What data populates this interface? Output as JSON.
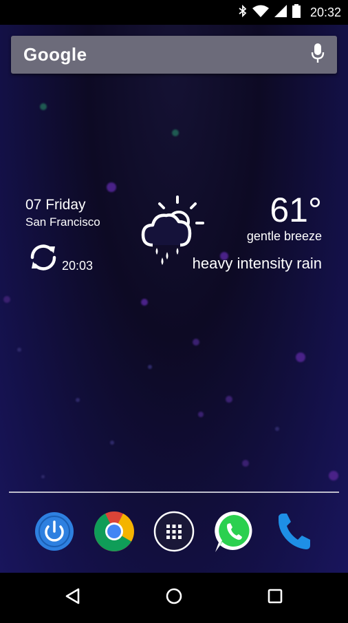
{
  "status_bar": {
    "time": "20:32",
    "icons": [
      "bluetooth-icon",
      "wifi-icon",
      "signal-icon",
      "battery-icon"
    ]
  },
  "search": {
    "logo_text": "Google",
    "mic_icon": "mic-icon"
  },
  "weather_widget": {
    "date": "07 Friday",
    "city": "San Francisco",
    "last_updated": "20:03",
    "temperature": "61°",
    "wind": "gentle breeze",
    "condition": "heavy intensity rain",
    "condition_icon": "sun-cloud-rain-icon",
    "refresh_icon": "refresh-icon"
  },
  "dock": {
    "apps": [
      {
        "name": "power-app",
        "icon": "power-icon",
        "color": "#2e80e0"
      },
      {
        "name": "chrome-app",
        "icon": "chrome-icon"
      },
      {
        "name": "app-drawer",
        "icon": "grid-icon"
      },
      {
        "name": "whatsapp-app",
        "icon": "whatsapp-icon",
        "color": "#2bd04f"
      },
      {
        "name": "phone-app",
        "icon": "phone-icon",
        "color": "#1e8fe6"
      }
    ]
  },
  "nav_bar": {
    "buttons": [
      "back-icon",
      "home-icon",
      "recents-icon"
    ]
  },
  "colors": {
    "wallpaper": "#14114a",
    "search_bar": "#6c6b7a"
  }
}
